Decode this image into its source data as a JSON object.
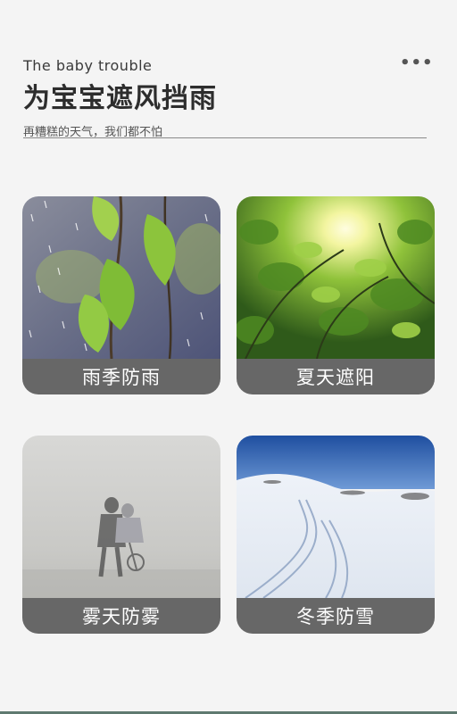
{
  "header": {
    "subtitle_en": "The baby trouble",
    "title_cn": "为宝宝遮风挡雨",
    "tagline": "再糟糕的天气，我们都不怕"
  },
  "menu": {
    "more_glyph": "•••"
  },
  "cards": [
    {
      "label": "雨季防雨",
      "scene": "rain-leaves"
    },
    {
      "label": "夏天遮阳",
      "scene": "sun-leaves"
    },
    {
      "label": "雾天防雾",
      "scene": "fog-cyclists"
    },
    {
      "label": "冬季防雪",
      "scene": "snow-field"
    }
  ],
  "colors": {
    "label_bg": "#676767",
    "label_text": "#ffffff",
    "page_bg": "#f4f4f4",
    "accent_bottom": "#5f7a70"
  }
}
